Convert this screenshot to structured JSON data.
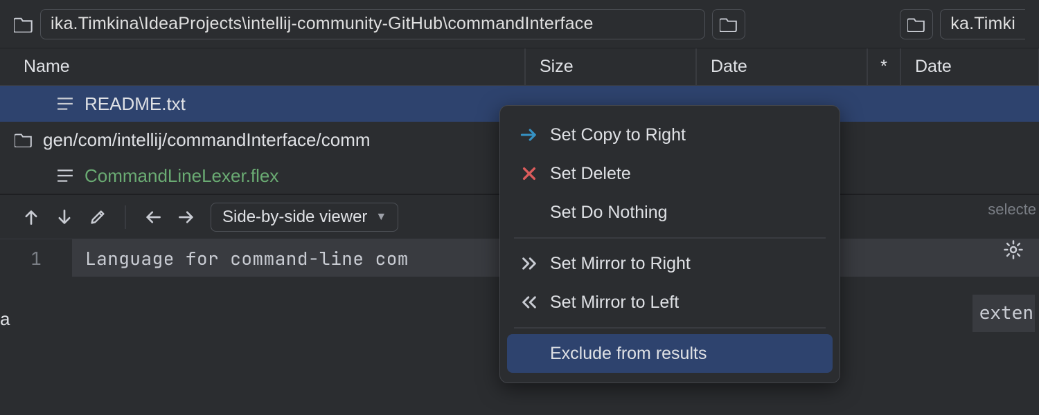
{
  "path_bar": {
    "left_path": "ika.Timkina\\IdeaProjects\\intellij-community-GitHub\\commandInterface",
    "right_path": "ka.Timki"
  },
  "columns": {
    "name": "Name",
    "size": "Size",
    "date_left": "Date",
    "star": "*",
    "date_right": "Date"
  },
  "tree": {
    "items": [
      {
        "icon": "text-lines",
        "label": "README.txt",
        "selected": true,
        "indent": 1,
        "color": "default"
      },
      {
        "icon": "folder",
        "label": "gen/com/intellij/commandInterface/comm",
        "selected": false,
        "indent": 0,
        "color": "default"
      },
      {
        "icon": "text-lines",
        "label": "CommandLineLexer.flex",
        "selected": false,
        "indent": 1,
        "color": "green"
      }
    ]
  },
  "diff_toolbar": {
    "viewer_label": "Side-by-side viewer"
  },
  "editor": {
    "line_number": "1",
    "line_text": "Language for command-line com"
  },
  "context_menu": {
    "items": [
      {
        "icon": "arrow-right-blue",
        "label": "Set Copy to Right"
      },
      {
        "icon": "x-red",
        "label": "Set Delete"
      },
      {
        "icon": "",
        "label": "Set Do Nothing"
      },
      {
        "sep": true
      },
      {
        "icon": "chevrons-right",
        "label": "Set Mirror to Right"
      },
      {
        "icon": "chevrons-left",
        "label": "Set Mirror to Left"
      },
      {
        "sep": true
      },
      {
        "icon": "",
        "label": "Exclude from results",
        "active": true
      }
    ]
  },
  "right_panel": {
    "hint": "selecte",
    "code_tail": "exten"
  },
  "left_edge": "a"
}
